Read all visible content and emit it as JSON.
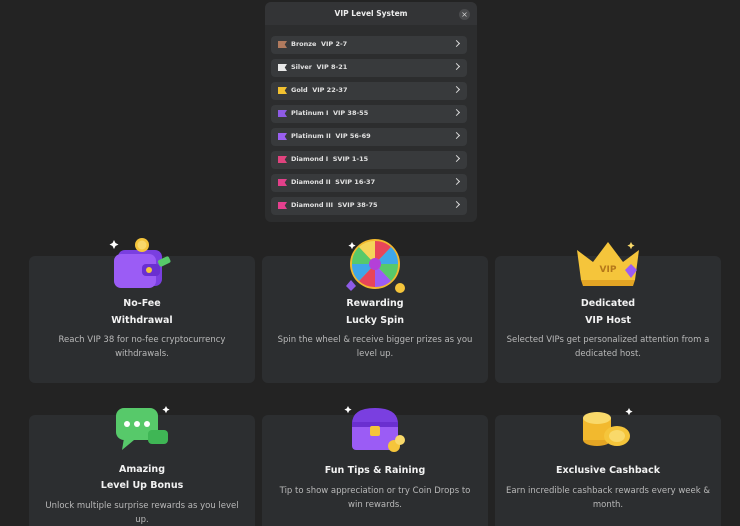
{
  "panel": {
    "title": "VIP Level System",
    "close_glyph": "×",
    "levels": [
      {
        "label": "Bronze  VIP 2-7",
        "color": "#b07a5e",
        "icon": "bronze-flag-icon"
      },
      {
        "label": "Silver  VIP 8-21",
        "color": "#e8e8e8",
        "icon": "silver-flag-icon"
      },
      {
        "label": "Gold  VIP 22-37",
        "color": "#f2c130",
        "icon": "gold-flag-icon"
      },
      {
        "label": "Platinum I  VIP 38-55",
        "color": "#8e5be6",
        "icon": "platinum-flag-icon"
      },
      {
        "label": "Platinum II  VIP 56-69",
        "color": "#9a5ff0",
        "icon": "platinum-flag-icon"
      },
      {
        "label": "Diamond I  SVIP 1-15",
        "color": "#e0437e",
        "icon": "diamond-flag-icon"
      },
      {
        "label": "Diamond II  SVIP 16-37",
        "color": "#e2408a",
        "icon": "diamond-flag-icon"
      },
      {
        "label": "Diamond III  SVIP 38-75",
        "color": "#e5408f",
        "icon": "diamond-flag-icon"
      }
    ]
  },
  "cards": [
    {
      "title_line1": "No-Fee",
      "title_line2": "Withdrawal",
      "desc": "Reach VIP 38 for no-fee cryptocurrency withdrawals.",
      "icon": "wallet-icon"
    },
    {
      "title_line1": "Rewarding",
      "title_line2": "Lucky Spin",
      "desc": "Spin the wheel & receive bigger prizes as you level up.",
      "icon": "prize-wheel-icon"
    },
    {
      "title_line1": "Dedicated",
      "title_line2": "VIP Host",
      "desc": "Selected VIPs get personalized attention from a dedicated host.",
      "icon": "vip-crown-icon"
    },
    {
      "title_line1": "Amazing",
      "title_line2": "Level Up Bonus",
      "desc": "Unlock multiple surprise rewards as you level up.",
      "icon": "chat-bubble-icon"
    },
    {
      "title_line1": "Fun Tips & Raining",
      "title_line2": "",
      "desc": "Tip to show appreciation or try Coin Drops to win rewards.",
      "icon": "treasure-chest-icon"
    },
    {
      "title_line1": "Exclusive Cashback",
      "title_line2": "",
      "desc": "Earn incredible cashback rewards every week & month.",
      "icon": "coin-stack-icon"
    }
  ]
}
